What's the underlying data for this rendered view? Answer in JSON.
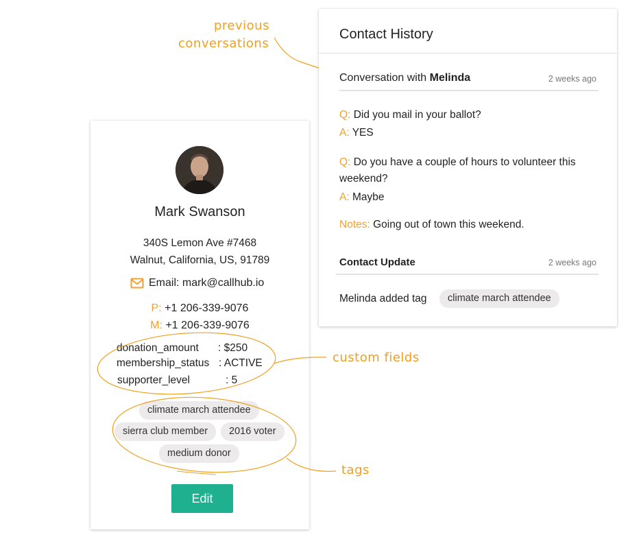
{
  "contact": {
    "name": "Mark Swanson",
    "address_line1": "340S Lemon Ave #7468",
    "address_line2": "Walnut, California, US, 91789",
    "email_label": "Email: mark@callhub.io",
    "phone_prefix": "P:",
    "phone": "+1 206-339-9076",
    "mobile_prefix": "M:",
    "mobile": "+1 206-339-9076",
    "custom_fields": [
      {
        "key": "donation_amount",
        "value": ": $250"
      },
      {
        "key": "membership_status",
        "value": ": ACTIVE"
      },
      {
        "key": "supporter_level",
        "value": ": 5"
      }
    ],
    "tags": [
      "climate march attendee",
      "sierra club member",
      "2016 voter",
      "medium donor"
    ],
    "edit_label": "Edit"
  },
  "history": {
    "title": "Contact History",
    "conversation": {
      "prefix": "Conversation with ",
      "person": "Melinda",
      "time": "2 weeks ago",
      "q_label": "Q:",
      "a_label": "A:",
      "q1": "Did you mail in your ballot?",
      "a1": "YES",
      "q2": "Do you have a couple of hours to volunteer this weekend?",
      "a2": "Maybe",
      "notes_label": "Notes:",
      "notes": "Going out of town this weekend."
    },
    "update": {
      "title": "Contact Update",
      "time": "2 weeks ago",
      "text": "Melinda added tag",
      "tag": "climate march attendee"
    }
  },
  "annotations": {
    "previous_line1": "previous",
    "previous_line2": "conversations",
    "custom_fields": "custom fields",
    "tags": "tags"
  },
  "colors": {
    "accent": "#f0a030",
    "edit_button": "#1fb08f",
    "tag_bg": "#eceaea"
  },
  "icons": {
    "email": "envelope-icon",
    "avatar": "profile-photo"
  }
}
